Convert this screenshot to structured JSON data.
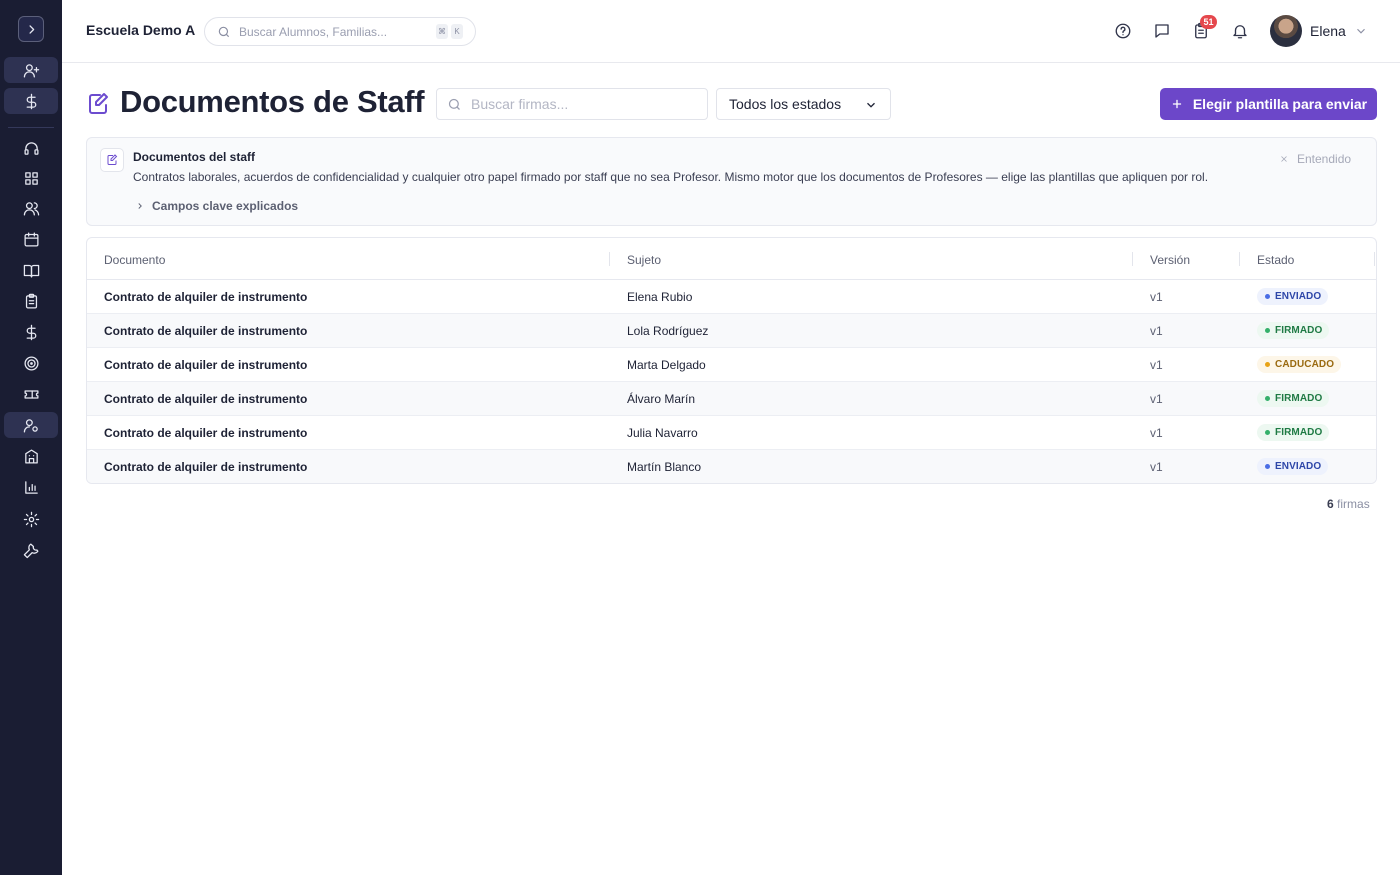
{
  "topbar": {
    "school_name": "Escuela Demo A",
    "search_placeholder": "Buscar Alumnos, Familias...",
    "shortcut_keys": [
      "⌘",
      "K"
    ],
    "tasks_badge": "51",
    "user_name": "Elena"
  },
  "page": {
    "title": "Documentos de Staff",
    "search_placeholder": "Buscar firmas...",
    "status_filter": "Todos los estados",
    "primary_action": "Elegir plantilla para enviar"
  },
  "info": {
    "title": "Documentos del staff",
    "text": "Contratos laborales, acuerdos de confidencialidad y cualquier otro papel firmado por staff que no sea Profesor. Mismo motor que los documentos de Profesores — elige las plantillas que apliquen por rol.",
    "dismiss": "Entendido",
    "expand": "Campos clave explicados"
  },
  "table": {
    "headers": [
      "Documento",
      "Sujeto",
      "Versión",
      "Estado"
    ],
    "rows": [
      {
        "document": "Contrato de alquiler de instrumento",
        "subject": "Elena Rubio",
        "version": "v1",
        "status": "ENVIADO"
      },
      {
        "document": "Contrato de alquiler de instrumento",
        "subject": "Lola Rodríguez",
        "version": "v1",
        "status": "FIRMADO"
      },
      {
        "document": "Contrato de alquiler de instrumento",
        "subject": "Marta Delgado",
        "version": "v1",
        "status": "CADUCADO"
      },
      {
        "document": "Contrato de alquiler de instrumento",
        "subject": "Álvaro Marín",
        "version": "v1",
        "status": "FIRMADO"
      },
      {
        "document": "Contrato de alquiler de instrumento",
        "subject": "Julia Navarro",
        "version": "v1",
        "status": "FIRMADO"
      },
      {
        "document": "Contrato de alquiler de instrumento",
        "subject": "Martín Blanco",
        "version": "v1",
        "status": "ENVIADO"
      }
    ]
  },
  "footer": {
    "count": "6",
    "count_label": "firmas"
  },
  "colors": {
    "sidebar_bg": "#1a1d33",
    "accent": "#6c47c9",
    "status_enviado": "#4a6de5",
    "status_firmado": "#34b06a",
    "status_caducado": "#e8a317"
  },
  "sidebar": {
    "icons": [
      "chevron-right-icon",
      "user-plus-icon",
      "dollar-icon",
      "headset-icon",
      "dashboard-icon",
      "users-icon",
      "calendar-icon",
      "book-icon",
      "clipboard-icon",
      "dollar-icon",
      "target-icon",
      "ticket-icon",
      "user-settings-icon",
      "building-icon",
      "bar-chart-icon",
      "gear-icon",
      "wrench-icon"
    ]
  }
}
